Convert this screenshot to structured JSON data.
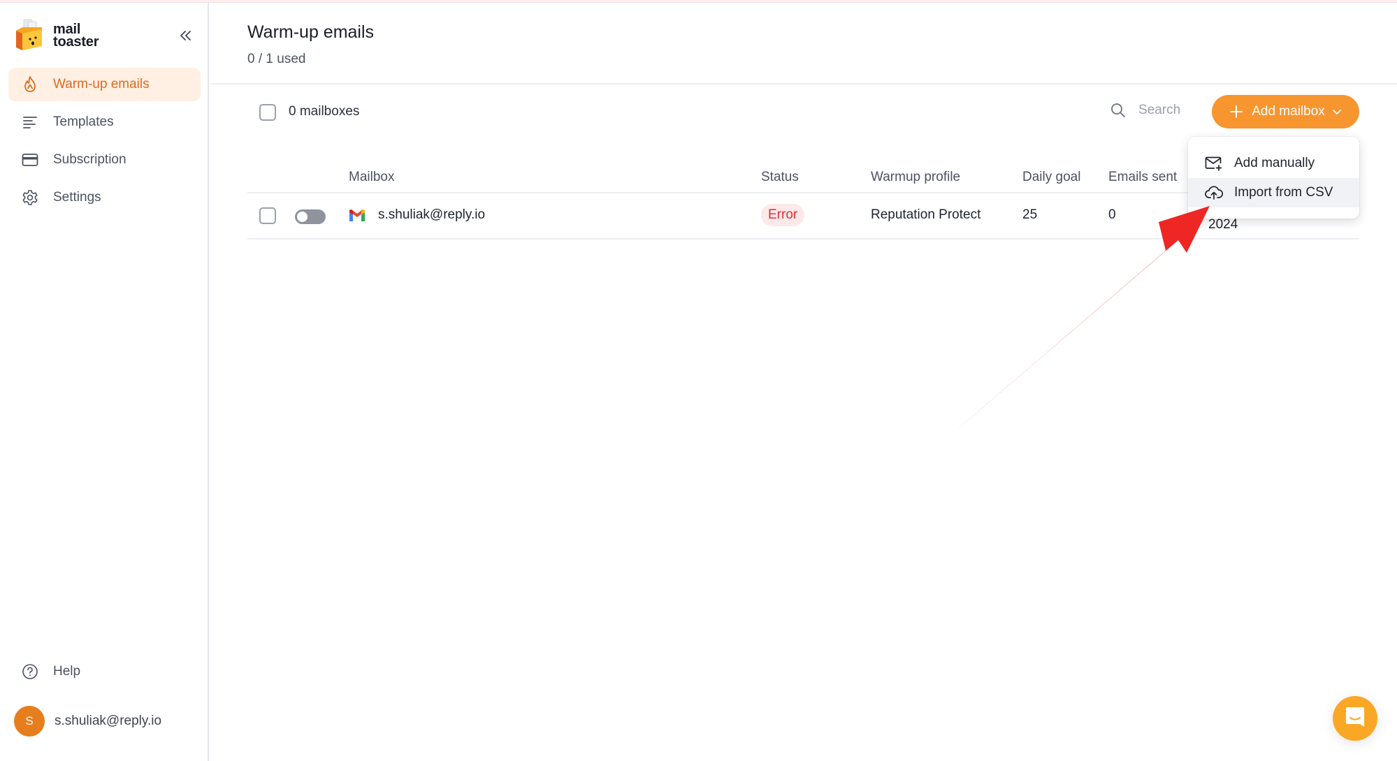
{
  "app": {
    "brand_line1": "mail",
    "brand_line2": "toaster",
    "accent_color": "#f7952e"
  },
  "sidebar": {
    "collapse_icon": "double-chevron-left-icon",
    "items": [
      {
        "label": "Warm-up emails",
        "icon": "flame-icon",
        "active": true
      },
      {
        "label": "Templates",
        "icon": "text-lines-icon",
        "active": false
      },
      {
        "label": "Subscription",
        "icon": "credit-card-icon",
        "active": false
      },
      {
        "label": "Settings",
        "icon": "gear-icon",
        "active": false
      }
    ],
    "help_label": "Help",
    "user": {
      "initial": "S",
      "email": "s.shuliak@reply.io"
    }
  },
  "header": {
    "title": "Warm-up emails",
    "usage": "0 / 1 used"
  },
  "toolbar": {
    "selected_count": "0 mailboxes",
    "search_placeholder": "Search",
    "search_value": "",
    "add_button_label": "Add mailbox"
  },
  "dropdown": {
    "items": [
      {
        "label": "Add manually",
        "icon": "mail-plus-icon"
      },
      {
        "label": "Import from CSV",
        "icon": "cloud-upload-icon",
        "highlighted": true
      }
    ]
  },
  "table": {
    "columns": [
      "Mailbox",
      "Status",
      "Warmup profile",
      "Daily goal",
      "Emails sent"
    ],
    "rows": [
      {
        "email": "s.shuliak@reply.io",
        "provider": "gmail",
        "enabled": false,
        "status": "Error",
        "warmup_profile": "Reputation Protect",
        "daily_goal": "25",
        "emails_sent": "0",
        "extra_partial": "2024"
      }
    ]
  },
  "annotation": {
    "type": "arrow",
    "color": "#ee2624",
    "points_to": "Import from CSV"
  }
}
